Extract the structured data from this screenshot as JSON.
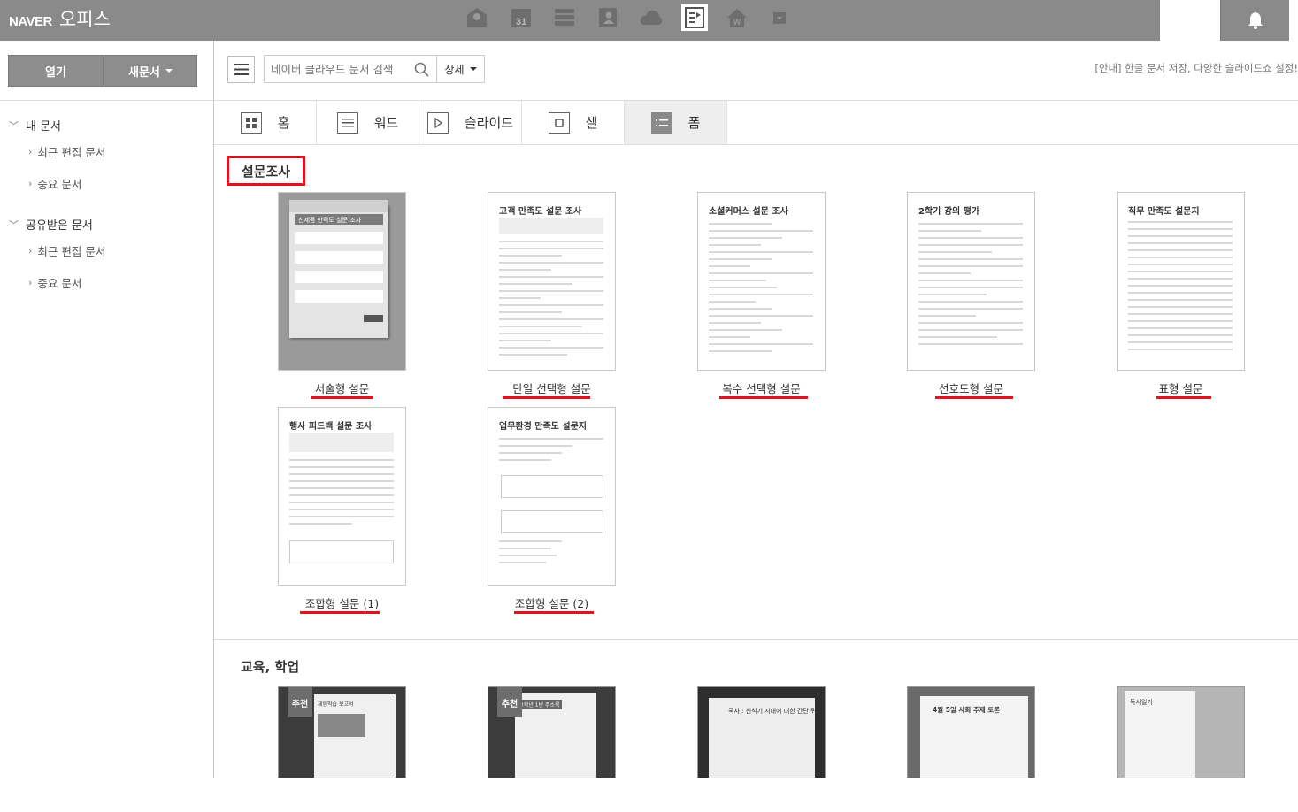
{
  "header": {
    "brand": "NAVER",
    "product": "오피스",
    "app_icons": [
      "mail-icon",
      "calendar-icon",
      "list-icon",
      "contacts-icon",
      "cloud-icon",
      "office-icon",
      "home-icon",
      "more-icon"
    ],
    "notification_icon": "bell-icon"
  },
  "sidebar": {
    "open_label": "열기",
    "new_label": "새문서",
    "groups": [
      {
        "label": "내 문서",
        "items": [
          {
            "label": "최근 편집 문서"
          },
          {
            "label": "중요 문서"
          }
        ]
      },
      {
        "label": "공유받은 문서",
        "items": [
          {
            "label": "최근 편집 문서"
          },
          {
            "label": "중요 문서"
          }
        ]
      }
    ]
  },
  "toolbar": {
    "search_placeholder": "네이버 클라우드 문서 검색",
    "detail_label": "상세",
    "notice": "[안내] 한글 문서 저장, 다양한 슬라이드쇼 설정!"
  },
  "tabs": [
    {
      "label": "홈",
      "icon": "grid-icon"
    },
    {
      "label": "워드",
      "icon": "word-icon"
    },
    {
      "label": "슬라이드",
      "icon": "slide-icon"
    },
    {
      "label": "셀",
      "icon": "cell-icon"
    },
    {
      "label": "폼",
      "icon": "form-icon",
      "active": true
    }
  ],
  "section1": {
    "title": "설문조사",
    "templates": [
      {
        "label": "서술형 설문",
        "doc_title": "신제품 만족도 설문 조사"
      },
      {
        "label": "단일 선택형 설문",
        "doc_title": "고객 만족도 설문 조사"
      },
      {
        "label": "복수 선택형 설문",
        "doc_title": "소셜커머스 설문 조사"
      },
      {
        "label": "선호도형 설문",
        "doc_title": "2학기 강의 평가"
      },
      {
        "label": "표형 설문",
        "doc_title": "직무 만족도 설문지"
      },
      {
        "label": "조합형 설문 (1)",
        "doc_title": "행사 피드백 설문 조사"
      },
      {
        "label": "조합형 설문 (2)",
        "doc_title": "업무환경 만족도 설문지"
      }
    ]
  },
  "section2": {
    "title": "교육, 학업",
    "recommended_label": "추천",
    "templates": [
      {
        "doc_title": "체험학습 보고서",
        "recommended": true
      },
      {
        "doc_title": "2학년 1반 주소록",
        "recommended": true
      },
      {
        "doc_title": "국사 : 신석기 시대에 대한 간단 퀴즈",
        "recommended": false
      },
      {
        "doc_title": "4월 5일 사회 주제 토론",
        "recommended": false
      },
      {
        "doc_title": "독서일기",
        "recommended": false
      }
    ]
  },
  "colors": {
    "topbar": "#8a8a8a",
    "highlight": "#e0131f",
    "button": "#8d8d8d"
  }
}
